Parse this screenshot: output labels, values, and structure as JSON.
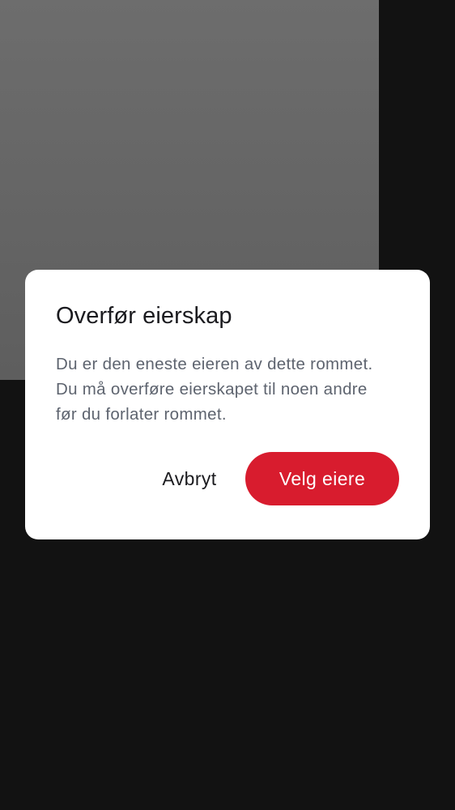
{
  "dialog": {
    "title": "Overfør eierskap",
    "body_lines": [
      "Du er den eneste eieren av dette rommet.",
      "Du må overføre eierskapet til noen andre",
      "før du forlater rommet."
    ],
    "cancel_label": "Avbryt",
    "confirm_label": "Velg eiere"
  },
  "colors": {
    "background": "#121212",
    "dialog_surface": "#ffffff",
    "accent": "#d81c2e",
    "title_text": "#1b1b1f",
    "body_text": "#5e646f"
  }
}
